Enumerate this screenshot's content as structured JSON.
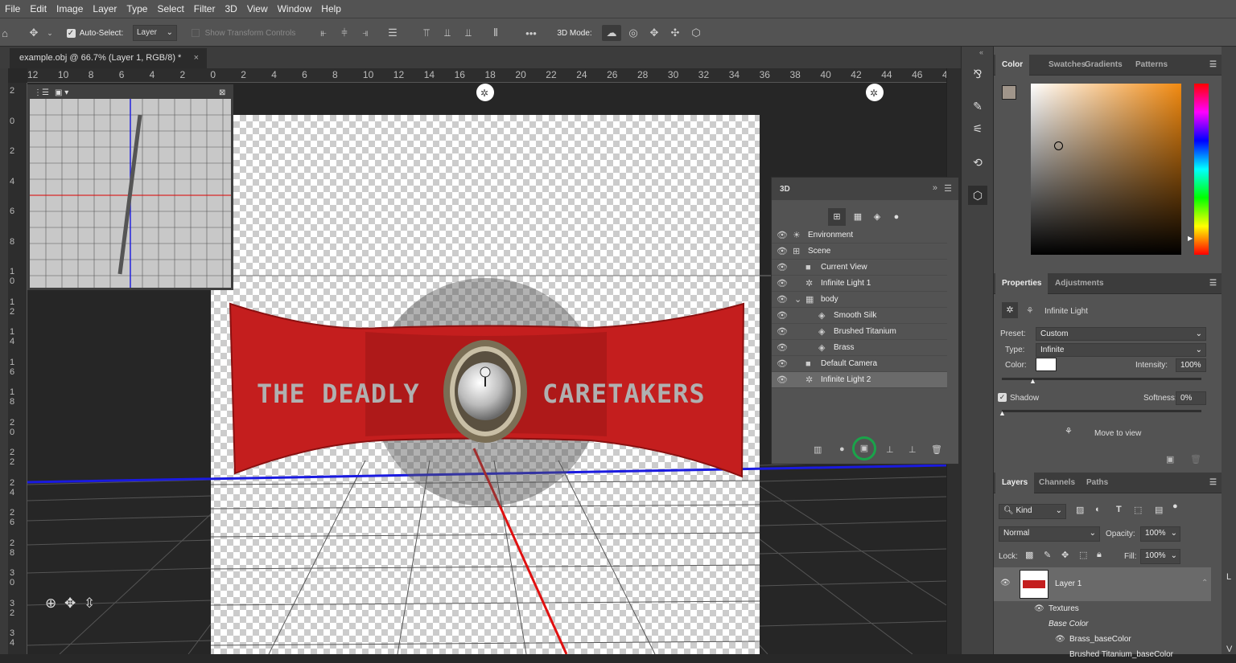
{
  "menu": [
    "File",
    "Edit",
    "Image",
    "Layer",
    "Type",
    "Select",
    "Filter",
    "3D",
    "View",
    "Window",
    "Help"
  ],
  "options": {
    "auto_select_label": "Auto-Select:",
    "auto_select_value": "Layer",
    "show_transform": "Show Transform Controls",
    "more": "•••",
    "mode_label": "3D Mode:"
  },
  "document": {
    "tab_title": "example.obj @ 66.7% (Layer 1, RGB/8) *",
    "close": "×"
  },
  "rulers": {
    "h": [
      "12",
      "10",
      "8",
      "6",
      "4",
      "2",
      "0",
      "2",
      "4",
      "6",
      "8",
      "10",
      "12",
      "14",
      "16",
      "18",
      "20",
      "22",
      "24",
      "26",
      "28",
      "30",
      "32",
      "34",
      "36",
      "38",
      "40",
      "42",
      "44",
      "46",
      "4"
    ],
    "v": [
      "2",
      "0",
      "2",
      "4",
      "6",
      "8",
      "1 0",
      "1 2",
      "1 4",
      "1 6",
      "1 8",
      "2 0",
      "2 2",
      "2 4",
      "2 6",
      "2 8",
      "3 0",
      "3 2",
      "3 4"
    ]
  },
  "model": {
    "text_left": "THE DEADLY",
    "text_right": "CARETAKERS"
  },
  "panel3d": {
    "title": "3D",
    "items": [
      {
        "label": "Environment",
        "indent": 0,
        "icon": "environment-icon",
        "glyph": "☀"
      },
      {
        "label": "Scene",
        "indent": 0,
        "icon": "scene-icon",
        "glyph": "⊞"
      },
      {
        "label": "Current View",
        "indent": 1,
        "icon": "camera-icon",
        "glyph": "■"
      },
      {
        "label": "Infinite Light 1",
        "indent": 1,
        "icon": "light-icon",
        "glyph": "✲"
      },
      {
        "label": "body",
        "indent": 1,
        "icon": "mesh-icon",
        "glyph": "▦",
        "expand": "⌄"
      },
      {
        "label": "Smooth Silk",
        "indent": 2,
        "icon": "material-icon",
        "glyph": "◈"
      },
      {
        "label": "Brushed Titanium",
        "indent": 2,
        "icon": "material-icon",
        "glyph": "◈"
      },
      {
        "label": "Brass",
        "indent": 2,
        "icon": "material-icon",
        "glyph": "◈"
      },
      {
        "label": "Default Camera",
        "indent": 1,
        "icon": "camera-icon",
        "glyph": "■"
      },
      {
        "label": "Infinite Light 2",
        "indent": 1,
        "icon": "light-icon",
        "glyph": "✲",
        "selected": true
      }
    ]
  },
  "color_panel": {
    "tabs": [
      "Color",
      "Swatches",
      "Gradients",
      "Patterns"
    ]
  },
  "properties": {
    "tabs": [
      "Properties",
      "Adjustments"
    ],
    "heading": "Infinite Light",
    "preset_label": "Preset:",
    "preset": "Custom",
    "type_label": "Type:",
    "type": "Infinite",
    "color_label": "Color:",
    "intensity_label": "Intensity:",
    "intensity": "100%",
    "shadow_label": "Shadow",
    "softness_label": "Softness:",
    "softness": "0%",
    "move_to_view": "Move to view"
  },
  "layers": {
    "tabs": [
      "Layers",
      "Channels",
      "Paths"
    ],
    "kind": "Kind",
    "blend": "Normal",
    "opacity_label": "Opacity:",
    "opacity": "100%",
    "lock_label": "Lock:",
    "fill_label": "Fill:",
    "fill": "100%",
    "layer_name": "Layer 1",
    "textures": "Textures",
    "base_color": "Base Color",
    "tex1": "Brass_baseColor",
    "tex2": "Brushed Titanium_baseColor"
  },
  "edge_letters": [
    "L",
    "V"
  ]
}
